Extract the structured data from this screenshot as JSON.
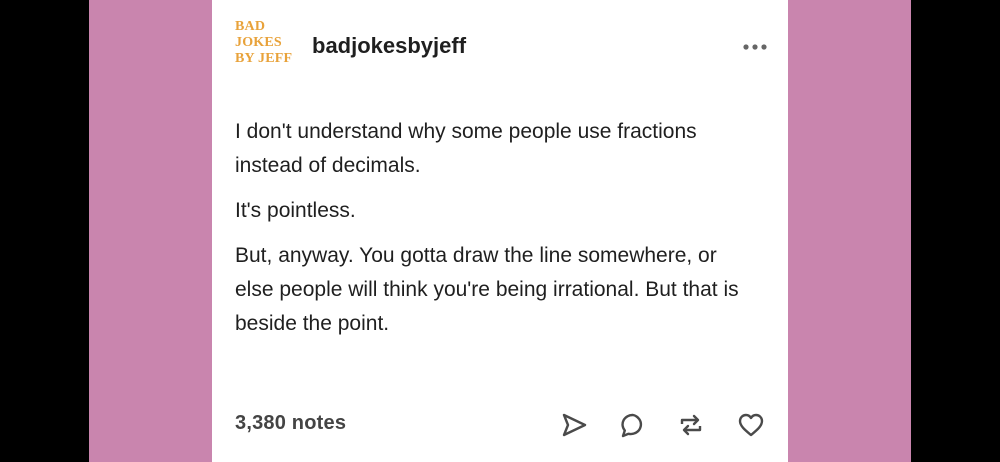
{
  "post": {
    "avatar_lines": [
      "BAD",
      "JOKES",
      "BY JEFF"
    ],
    "username": "badjokesbyjeff",
    "paragraphs": [
      "I don't understand why some people use fractions instead of decimals.",
      "It's pointless.",
      "But, anyway. You gotta draw the line somewhere, or else people will think you're being irrational. But that is beside the point."
    ],
    "notes": "3,380 notes"
  },
  "icons": [
    "more-icon",
    "share-icon",
    "reply-icon",
    "reblog-icon",
    "like-icon"
  ],
  "colors": {
    "background_side": "#c985ae",
    "card": "#ffffff",
    "avatar_text": "#e8a23a",
    "text": "#1f1f1f"
  }
}
